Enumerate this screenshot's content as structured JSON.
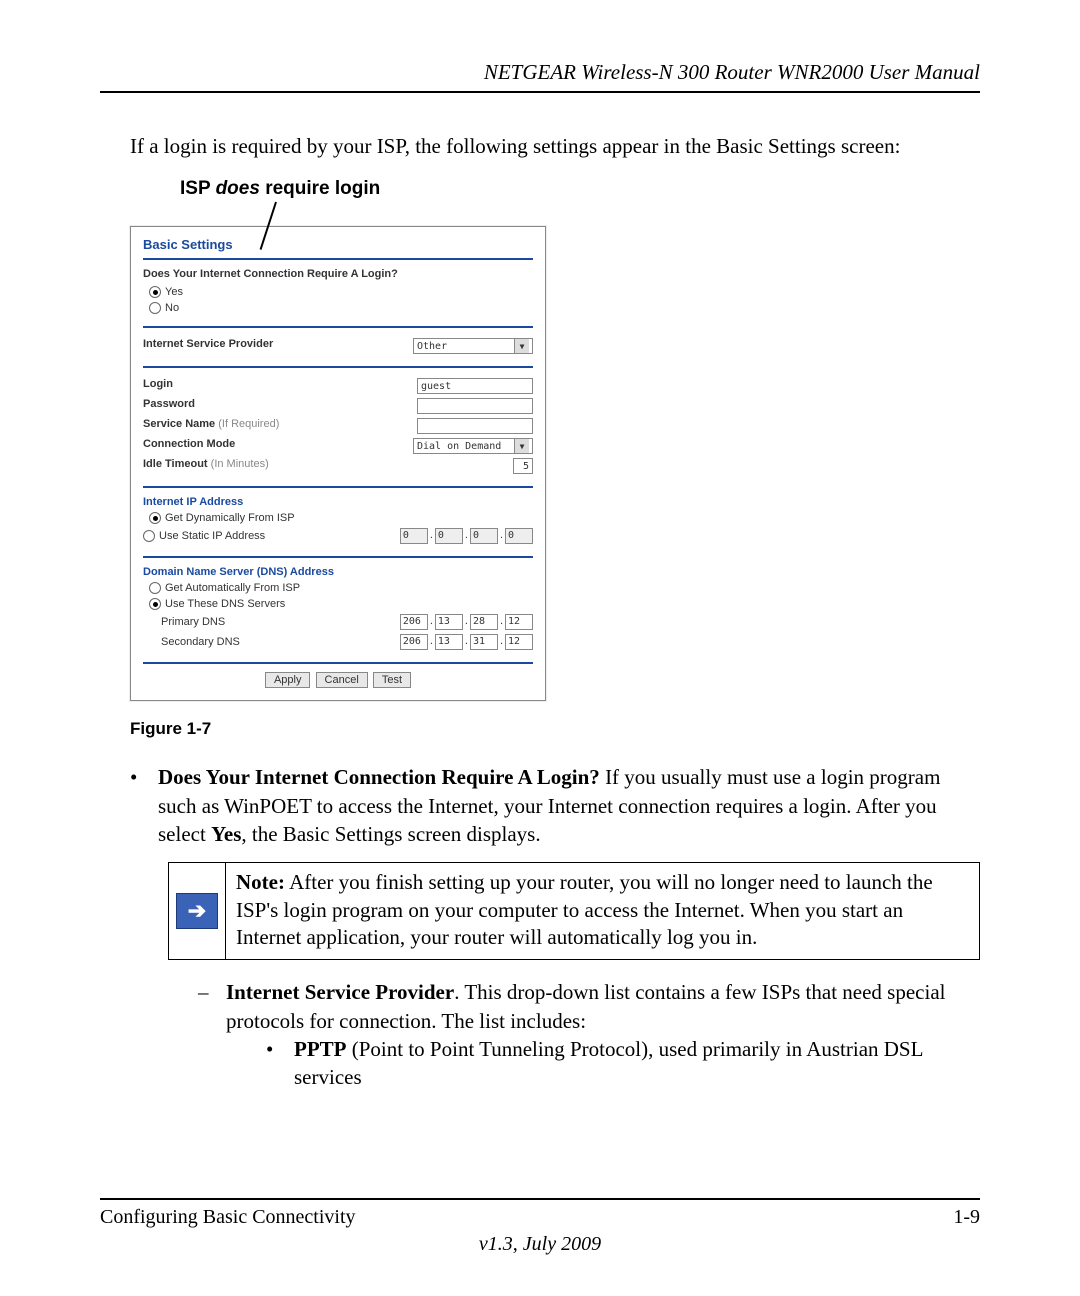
{
  "header": {
    "title": "NETGEAR Wireless-N 300 Router WNR2000 User Manual"
  },
  "intro": "If a login is required by your ISP, the following settings appear in the Basic Settings screen:",
  "callout": {
    "prefix": "ISP ",
    "em": "does",
    "suffix": " require login"
  },
  "panel": {
    "title": "Basic Settings",
    "q_login": "Does Your Internet Connection Require A Login?",
    "yes": "Yes",
    "no": "No",
    "isp_label": "Internet Service Provider",
    "isp_value": "Other",
    "login_label": "Login",
    "login_value": "guest",
    "password_label": "Password",
    "service_label": "Service Name",
    "service_hint": "(If Required)",
    "connmode_label": "Connection Mode",
    "connmode_value": "Dial on Demand",
    "idle_label": "Idle Timeout",
    "idle_hint": "(In Minutes)",
    "idle_value": "5",
    "ip_head": "Internet IP Address",
    "ip_dyn": "Get Dynamically From ISP",
    "ip_static": "Use Static IP Address",
    "ip_oct": [
      "0",
      "0",
      "0",
      "0"
    ],
    "dns_head": "Domain Name Server (DNS) Address",
    "dns_auto": "Get Automatically From ISP",
    "dns_use": "Use These DNS Servers",
    "primary_label": "Primary DNS",
    "primary_oct": [
      "206",
      "13",
      "28",
      "12"
    ],
    "secondary_label": "Secondary DNS",
    "secondary_oct": [
      "206",
      "13",
      "31",
      "12"
    ],
    "btn_apply": "Apply",
    "btn_cancel": "Cancel",
    "btn_test": "Test"
  },
  "figure_label": "Figure 1-7",
  "bullets": {
    "does_lead": "Does Your Internet Connection Require A Login?",
    "does_text": " If you usually must use a login program such as WinPOET to access the Internet, your Internet connection requires a login. After you select ",
    "does_yes": "Yes",
    "does_tail": ", the Basic Settings screen displays.",
    "note_lead": "Note:",
    "note_text": " After you finish setting up your router, you will no longer need to launch the ISP's login program on your computer to access the Internet. When you start an Internet application, your router will automatically log you in.",
    "isp_lead": "Internet Service Provider",
    "isp_text": ". This drop-down list contains a few ISPs that need special protocols for connection. The list includes:",
    "pptp_lead": "PPTP",
    "pptp_text": " (Point to Point Tunneling Protocol), used primarily in Austrian DSL services"
  },
  "footer": {
    "section": "Configuring Basic Connectivity",
    "page": "1-9",
    "version": "v1.3, July 2009"
  }
}
